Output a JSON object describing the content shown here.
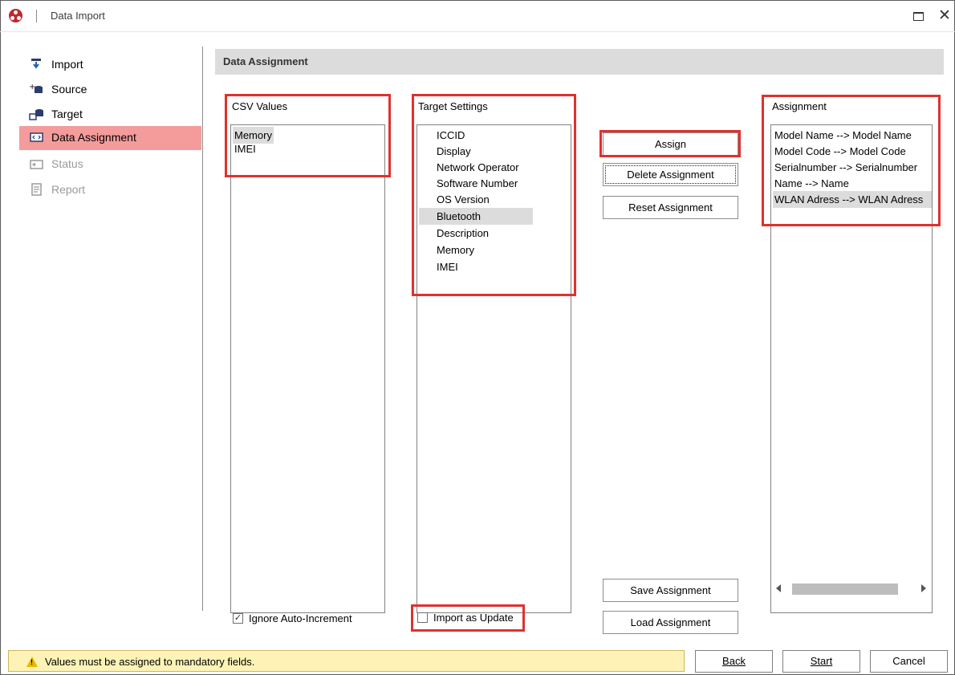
{
  "window": {
    "title": "Data Import"
  },
  "sidebar": {
    "items": [
      {
        "label": "Import",
        "icon": "import-arrow-icon"
      },
      {
        "label": "Source",
        "icon": "source-db-icon"
      },
      {
        "label": "Target",
        "icon": "target-db-icon"
      },
      {
        "label": "Data Assignment",
        "icon": "assignment-icon",
        "active": true
      },
      {
        "label": "Status",
        "icon": "status-icon",
        "disabled": true
      },
      {
        "label": "Report",
        "icon": "report-icon",
        "disabled": true
      }
    ]
  },
  "section": {
    "title": "Data Assignment"
  },
  "csv": {
    "label": "CSV Values",
    "items": [
      "Memory",
      "IMEI"
    ],
    "selected": "Memory"
  },
  "target": {
    "label": "Target Settings",
    "items": [
      "ICCID",
      "Display",
      "Network Operator",
      "Software Number",
      "OS Version",
      "Bluetooth",
      "Description",
      "Memory",
      "IMEI"
    ],
    "selected": "Bluetooth"
  },
  "assignment": {
    "label": "Assignment",
    "items": [
      "Model Name --> Model Name",
      "Model Code --> Model Code",
      "Serialnumber --> Serialnumber",
      "Name --> Name",
      "WLAN Adress --> WLAN Adress"
    ],
    "selected": "WLAN Adress --> WLAN Adress"
  },
  "buttons": {
    "assign": "Assign",
    "delete": "Delete Assignment",
    "reset": "Reset Assignment",
    "save": "Save Assignment",
    "load": "Load Assignment"
  },
  "options": {
    "ignore_auto_increment": {
      "label": "Ignore Auto-Increment",
      "checked": true
    },
    "import_as_update": {
      "label": "Import as Update",
      "checked": false
    }
  },
  "status": {
    "message": "Values must be assigned to mandatory fields."
  },
  "footer": {
    "back": "Back",
    "start": "Start",
    "cancel": "Cancel"
  },
  "colors": {
    "highlight_red": "#e0312d",
    "active_nav": "#f49b9b",
    "warning_bg": "#fdf3b6"
  }
}
